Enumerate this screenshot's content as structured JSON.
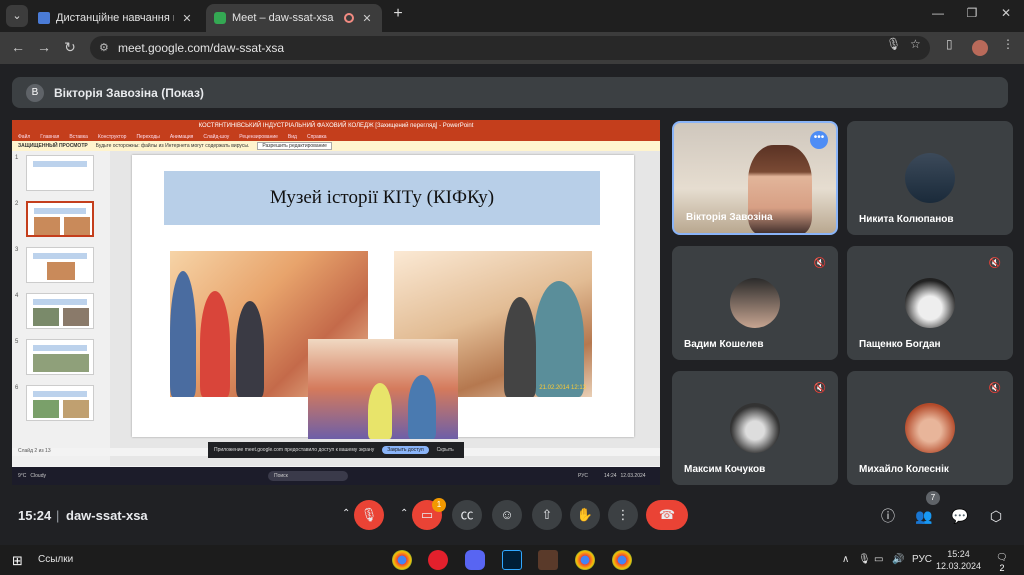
{
  "browser": {
    "tabs": [
      {
        "title": "Дистанційне навчання в ВСП "
      },
      {
        "title": "Meet – daw-ssat-xsa"
      }
    ],
    "url": "meet.google.com/daw-ssat-xsa"
  },
  "meet": {
    "presenter_label": "Вікторія Завозіна (Показ)",
    "presenter_initial": "В",
    "time": "15:24",
    "meeting_code": "daw-ssat-xsa",
    "people_count": "7",
    "alert_count": "1"
  },
  "presentation": {
    "window_title": "КОСТЯНТИНІВСЬКИЙ ІНДУСТРІАЛЬНИЙ ФАХОВИЙ КОЛЕДЖ [Захищений перегляд] - PowerPoint",
    "ribbon_tabs": [
      "Файл",
      "Главная",
      "Вставка",
      "Конструктор",
      "Переходы",
      "Анимация",
      "Слайд-шоу",
      "Рецензирование",
      "Вид",
      "Справка"
    ],
    "protected_label": "ЗАЩИЩЕННЫЙ ПРОСМОТР",
    "protected_msg": "Будьте осторожны: файлы из Интернета могут содержать вирусы.",
    "protected_btn": "Разрешить редактирование",
    "slide_title": "Музей історії КІТу (КІФКу)",
    "photo_stamp": "21.02.2014 12:13",
    "status_text": "Слайд 2 из 13",
    "thumb_numbers": [
      "1",
      "2",
      "3",
      "4",
      "5",
      "6"
    ],
    "share_msg": "Приложение meet.google.com предоставило доступ к вашему экрану",
    "share_open": "Закрыть доступ",
    "share_hide": "Скрыть",
    "mini_taskbar": {
      "weather": "9°C",
      "weather_desc": "Cloudy",
      "search": "Поиск",
      "lang": "РУС",
      "time": "14:24",
      "date": "12.03.2024"
    }
  },
  "participants": [
    {
      "name": "Вікторія Завозіна",
      "video": true
    },
    {
      "name": "Никита Колюпанов",
      "muted": false
    },
    {
      "name": "Вадим Кошелев",
      "muted": true
    },
    {
      "name": "Пащенко Богдан",
      "muted": true
    },
    {
      "name": "Максим Кочуков",
      "muted": true
    },
    {
      "name": "Михайло Колеснік",
      "muted": true
    }
  ],
  "taskbar": {
    "links_label": "Ссылки",
    "lang": "РУС",
    "time": "15:24",
    "date": "12.03.2024",
    "notif": "2"
  },
  "colors": {
    "end_call": "#ea4335",
    "accent": "#8ab4f8",
    "powerpoint": "#c43e1c"
  }
}
